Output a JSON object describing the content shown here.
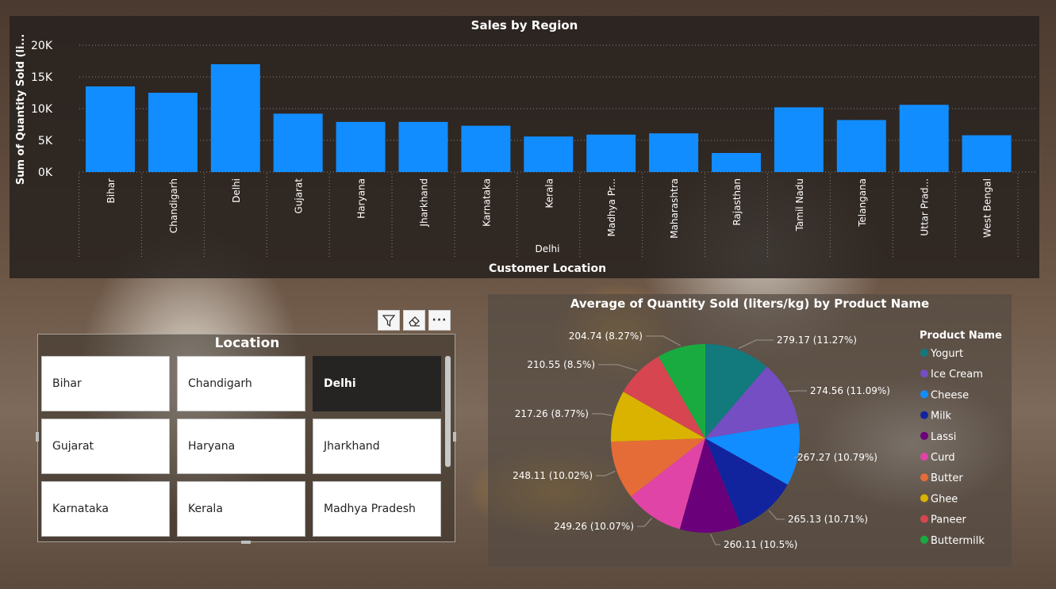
{
  "bar_chart": {
    "title": "Sales by Region",
    "ylabel": "Sum of Quantity Sold (li...",
    "axis_caption": "Delhi",
    "xlabel": "Customer Location",
    "bar_color": "#118DFF",
    "y_ticks": [
      "20K",
      "15K",
      "10K",
      "5K",
      "0K"
    ]
  },
  "chart_data": [
    {
      "type": "bar",
      "title": "Sales by Region",
      "xlabel": "Customer Location",
      "ylabel": "Sum of Quantity Sold (li...",
      "categories": [
        "Bihar",
        "Chandigarh",
        "Delhi",
        "Gujarat",
        "Haryana",
        "Jharkhand",
        "Karnataka",
        "Kerala",
        "Madhya Pr...",
        "Maharashtra",
        "Rajasthan",
        "Tamil Nadu",
        "Telangana",
        "Uttar Prad...",
        "West Bengal"
      ],
      "values": [
        13500,
        12500,
        17000,
        9200,
        7900,
        7900,
        7300,
        5600,
        5900,
        6100,
        3000,
        10200,
        8200,
        10600,
        5800
      ],
      "ylim": [
        0,
        20000
      ],
      "grid": true
    },
    {
      "type": "pie",
      "title": "Average of Quantity Sold (liters/kg) by Product Name",
      "legend_title": "Product Name",
      "legend_position": "right",
      "slices": [
        {
          "name": "Yogurt",
          "value": 279.17,
          "label": "279.17 (11.27%)",
          "color": "#12797D"
        },
        {
          "name": "Ice Cream",
          "value": 274.56,
          "label": "274.56 (11.09%)",
          "color": "#744EC2"
        },
        {
          "name": "Cheese",
          "value": 267.27,
          "label": "267.27 (10.79%)",
          "color": "#118DFF"
        },
        {
          "name": "Milk",
          "value": 265.13,
          "label": "265.13 (10.71%)",
          "color": "#12239E"
        },
        {
          "name": "Lassi",
          "value": 260.11,
          "label": "260.11 (10.5%)",
          "color": "#6B007B"
        },
        {
          "name": "Curd",
          "value": 249.26,
          "label": "249.26 (10.07%)",
          "color": "#E044A7"
        },
        {
          "name": "Butter",
          "value": 248.11,
          "label": "248.11 (10.02%)",
          "color": "#E66C37"
        },
        {
          "name": "Ghee",
          "value": 217.26,
          "label": "217.26 (8.77%)",
          "color": "#D9B300"
        },
        {
          "name": "Paneer",
          "value": 210.55,
          "label": "210.55 (8.5%)",
          "color": "#D64550"
        },
        {
          "name": "Buttermilk",
          "value": 204.74,
          "label": "204.74 (8.27%)",
          "color": "#1AAB40"
        }
      ]
    }
  ],
  "slicer": {
    "title": "Location",
    "items": [
      {
        "label": "Bihar",
        "selected": false
      },
      {
        "label": "Chandigarh",
        "selected": false
      },
      {
        "label": "Delhi",
        "selected": true
      },
      {
        "label": "Gujarat",
        "selected": false
      },
      {
        "label": "Haryana",
        "selected": false
      },
      {
        "label": "Jharkhand",
        "selected": false
      },
      {
        "label": "Karnataka",
        "selected": false
      },
      {
        "label": "Kerala",
        "selected": false
      },
      {
        "label": "Madhya Pradesh",
        "selected": false
      }
    ]
  },
  "toolbar": {
    "filter_icon": "filter-icon",
    "eraser_icon": "eraser-icon",
    "more_icon": "more-options-icon",
    "more_glyph": "···"
  },
  "pie_chart": {
    "title": "Average of Quantity Sold (liters/kg) by Product Name",
    "legend_title": "Product Name"
  }
}
